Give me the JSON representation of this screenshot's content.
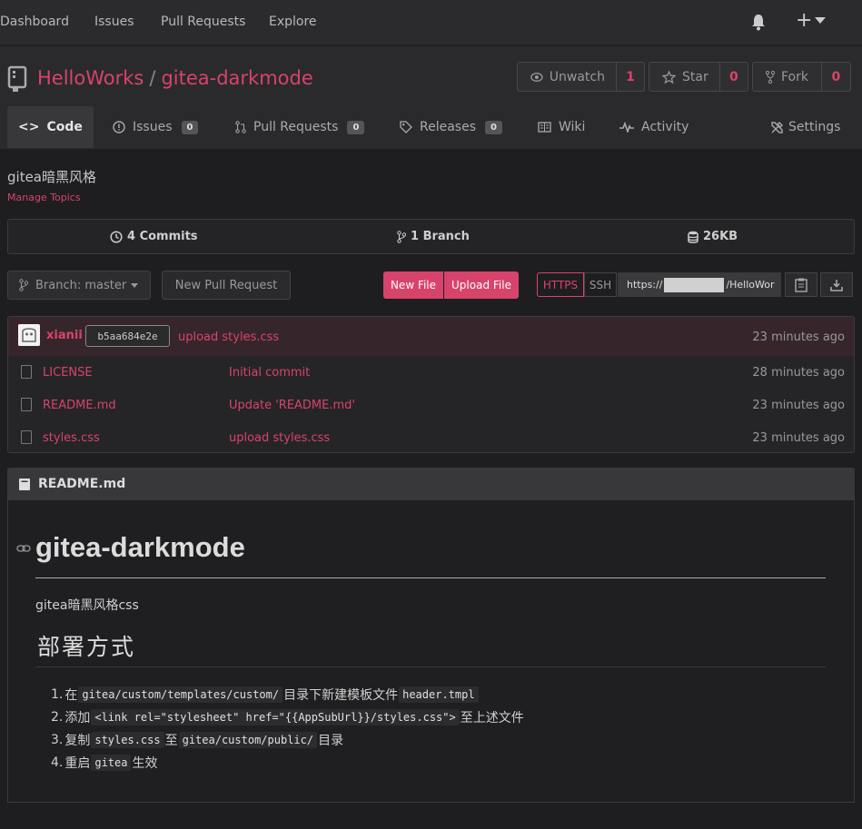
{
  "topnav": {
    "items": [
      "Dashboard",
      "Issues",
      "Pull Requests",
      "Explore"
    ],
    "plus_label": "+"
  },
  "repo": {
    "owner": "HelloWorks",
    "separator": "/",
    "name": "gitea-darkmode",
    "watch_label": "Unwatch",
    "watch_count": "1",
    "star_label": "Star",
    "star_count": "0",
    "fork_label": "Fork",
    "fork_count": "0"
  },
  "tabs": [
    {
      "label": "Code"
    },
    {
      "label": "Issues",
      "badge": "0"
    },
    {
      "label": "Pull Requests",
      "badge": "0"
    },
    {
      "label": "Releases",
      "badge": "0"
    },
    {
      "label": "Wiki"
    },
    {
      "label": "Activity"
    },
    {
      "label": "Settings"
    }
  ],
  "description": "gitea暗黑风格",
  "manage_topics": "Manage Topics",
  "stats": {
    "commits": "4 Commits",
    "branches": "1 Branch",
    "size": "26KB"
  },
  "toolbar": {
    "branch": "Branch: master",
    "new_pr": "New Pull Request",
    "new_file": "New File",
    "upload_file": "Upload File",
    "https": "HTTPS",
    "ssh": "SSH",
    "url_prefix": "https://",
    "url_suffix": "/HelloWor"
  },
  "latest_commit": {
    "author": "xianii",
    "sha": "b5aa684e2e",
    "message": "upload styles.css",
    "time": "23 minutes ago"
  },
  "files": [
    {
      "name": "LICENSE",
      "message": "Initial commit",
      "time": "28 minutes ago"
    },
    {
      "name": "README.md",
      "message": "Update 'README.md'",
      "time": "23 minutes ago"
    },
    {
      "name": "styles.css",
      "message": "upload styles.css",
      "time": "23 minutes ago"
    }
  ],
  "readme": {
    "filename": "README.md",
    "h1": "gitea-darkmode",
    "intro": "gitea暗黑风格css",
    "h2": "部署方式",
    "steps": [
      {
        "num": "1.",
        "parts": [
          "在",
          "gitea/custom/templates/custom/",
          "目录下新建模板文件",
          "header.tmpl",
          ""
        ]
      },
      {
        "num": "2.",
        "parts": [
          "添加",
          "<link rel=\"stylesheet\" href=\"{{AppSubUrl}}/styles.css\">",
          "至上述文件",
          "",
          ""
        ]
      },
      {
        "num": "3.",
        "parts": [
          "复制",
          "styles.css",
          "至",
          "gitea/custom/public/",
          "目录"
        ]
      },
      {
        "num": "4.",
        "parts": [
          "重启",
          "gitea",
          "生效",
          "",
          ""
        ]
      }
    ]
  },
  "colors": {
    "accent": "#d8436b",
    "background": "#1e1e20",
    "header": "#2b2b2d"
  }
}
